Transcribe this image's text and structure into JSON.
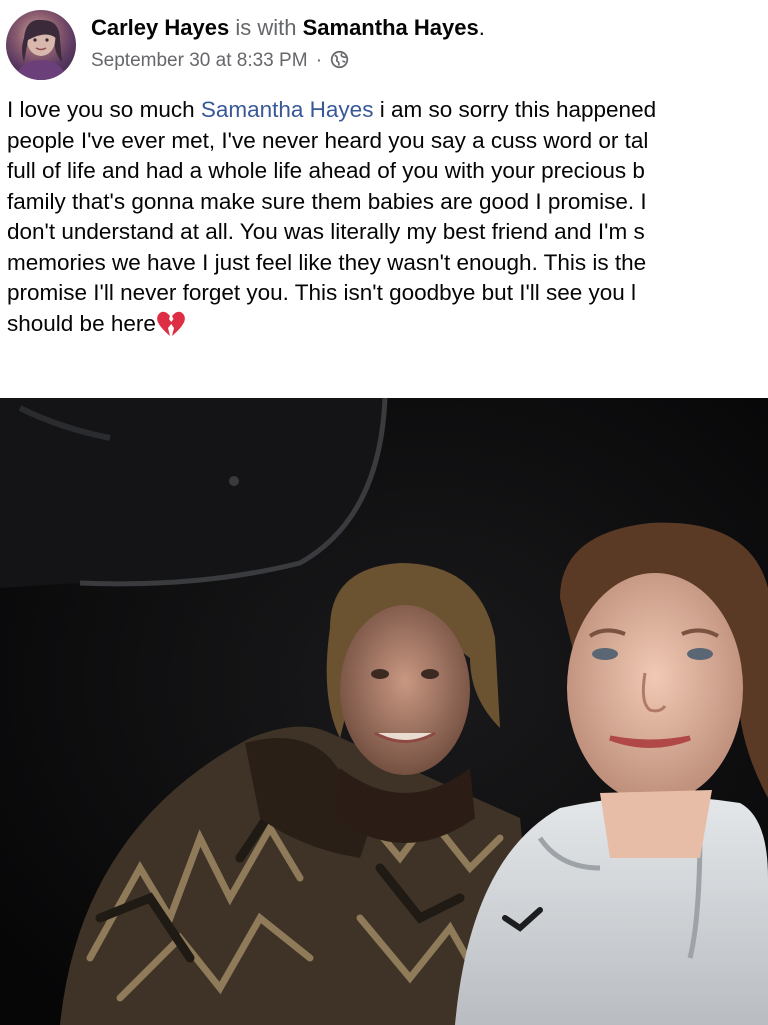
{
  "post": {
    "author": "Carley Hayes",
    "with_text": "is with",
    "tagged_user": "Samantha Hayes",
    "period": ".",
    "timestamp": "September 30 at 8:33 PM",
    "separator": "·",
    "privacy_icon": "globe-icon",
    "body": {
      "line1_before": "I love you so much ",
      "mention": "Samantha Hayes",
      "line1_after": " i am so sorry this happened",
      "line2": "people I've ever met, I've never heard you say a cuss word or tal",
      "line3": "full of life and had a whole life ahead of you with your precious b",
      "line4": "family that's gonna make sure them babies are good I promise. I",
      "line5": "don't understand at all. You was literally my best friend and I'm s",
      "line6": "memories we have I just feel like they wasn't enough. This is the",
      "line7": "promise I'll never forget you. This isn't goodbye but I'll see you l",
      "line8": "should be here",
      "emoji": "broken-heart-icon"
    },
    "photo": {
      "icon": "photo-image"
    }
  },
  "colors": {
    "link": "#385898",
    "secondary_text": "#65676b",
    "primary_text": "#050505"
  }
}
